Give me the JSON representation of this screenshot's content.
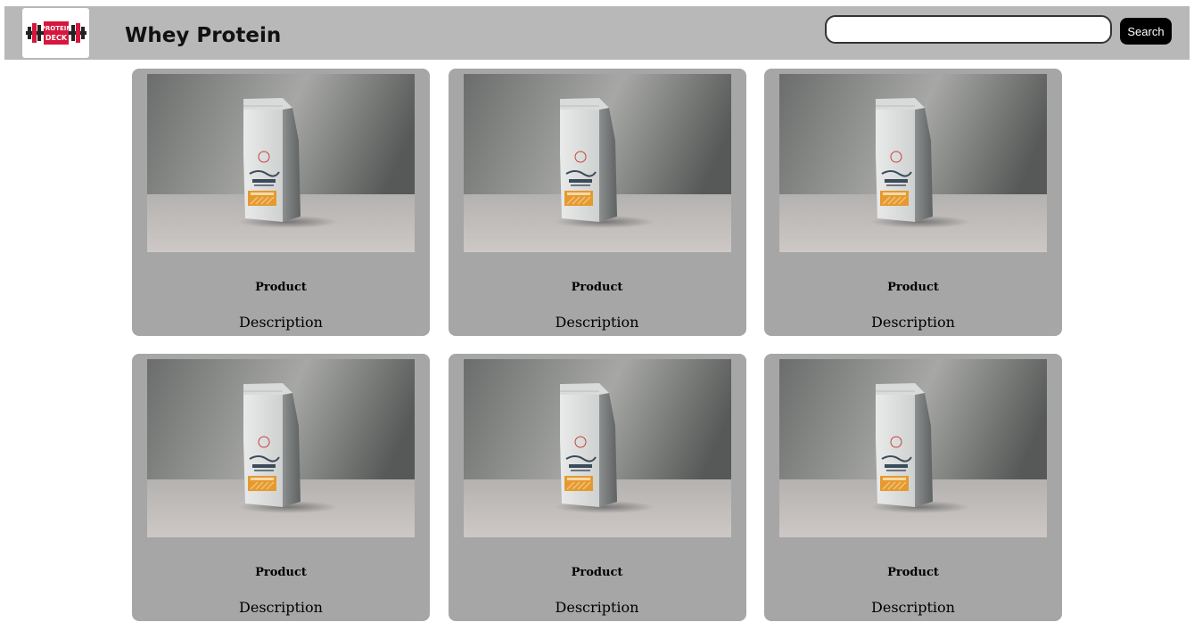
{
  "header": {
    "title": "Whey Protein",
    "logo_text": [
      "PROTEIN",
      "DECK"
    ]
  },
  "search": {
    "value": "",
    "placeholder": "",
    "button_label": "Search"
  },
  "products": [
    {
      "name": "Product",
      "description": "Description",
      "image": "coffee-bag-photo"
    },
    {
      "name": "Product",
      "description": "Description",
      "image": "coffee-bag-photo"
    },
    {
      "name": "Product",
      "description": "Description",
      "image": "coffee-bag-photo"
    },
    {
      "name": "Product",
      "description": "Description",
      "image": "coffee-bag-photo"
    },
    {
      "name": "Product",
      "description": "Description",
      "image": "coffee-bag-photo"
    },
    {
      "name": "Product",
      "description": "Description",
      "image": "coffee-bag-photo"
    }
  ],
  "colors": {
    "header_bg": "#b8b8b8",
    "card_bg": "#a6a6a6",
    "logo_red": "#d6163c",
    "button_bg": "#000000"
  }
}
